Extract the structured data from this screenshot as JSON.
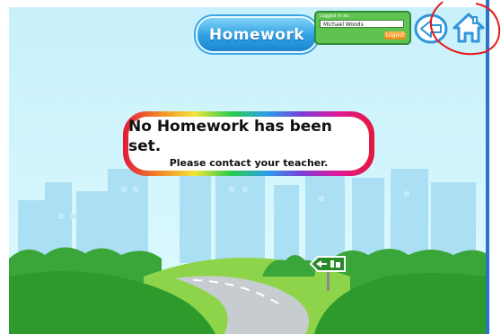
{
  "header": {
    "title": "Homework"
  },
  "login": {
    "caption": "Logged in as:",
    "username": "Michael Woods",
    "logout_label": "Logout"
  },
  "message": {
    "title": "No Homework has been set.",
    "subtitle": "Please contact your teacher."
  },
  "icons": {
    "back": "back-arrow-icon",
    "home": "home-icon"
  },
  "colors": {
    "sky": "#d2f5fd",
    "title_pill": "#2f9fe3",
    "login_panel": "#5fc34f",
    "logout": "#f08a12",
    "grass": "#2f9a2c",
    "highlight_circle": "#e21b1b"
  }
}
